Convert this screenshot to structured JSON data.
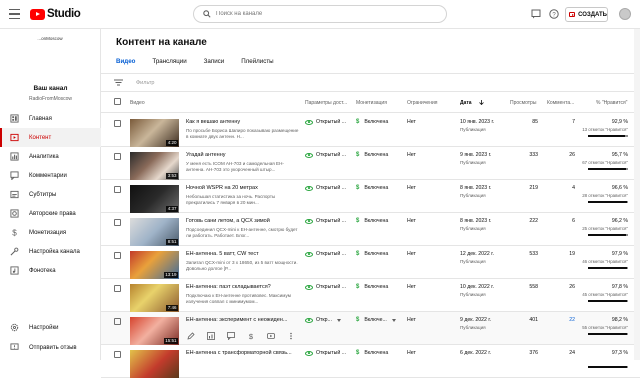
{
  "app": {
    "brand": "Studio",
    "brand_color": "#ff0000",
    "accent": "#065fd4"
  },
  "search": {
    "placeholder": "Поиск на канале"
  },
  "header": {
    "create_label": "СОЗДАТЬ"
  },
  "channel": {
    "logo_text": "...onMoscow",
    "name": "Ваш канал",
    "handle": "RadioFromMoscow"
  },
  "sidebar": {
    "items": [
      {
        "label": "Главная",
        "icon": "dashboard-icon"
      },
      {
        "label": "Контент",
        "icon": "content-icon",
        "active": true
      },
      {
        "label": "Аналитика",
        "icon": "analytics-icon"
      },
      {
        "label": "Комментарии",
        "icon": "comments-icon"
      },
      {
        "label": "Субтитры",
        "icon": "subtitles-icon"
      },
      {
        "label": "Авторские права",
        "icon": "copyright-icon"
      },
      {
        "label": "Монетизация",
        "icon": "monetization-icon"
      },
      {
        "label": "Настройка канала",
        "icon": "customization-icon"
      },
      {
        "label": "Фонотека",
        "icon": "audio-library-icon"
      }
    ],
    "bottom": [
      {
        "label": "Настройки",
        "icon": "settings-icon"
      },
      {
        "label": "Отправить отзыв",
        "icon": "feedback-icon"
      }
    ]
  },
  "main": {
    "title": "Контент на канале",
    "tabs": [
      "Видео",
      "Трансляции",
      "Записи",
      "Плейлисты"
    ],
    "filter_placeholder": "Фильтр",
    "columns": {
      "video": "Видео",
      "visibility": "Параметры дост...",
      "monetization": "Монетизация",
      "restrictions": "Ограничения",
      "date": "Дата",
      "views": "Просмотры",
      "comments": "Коммента...",
      "likes": "% \"Нравится\""
    }
  },
  "videos": [
    {
      "title": "Как я вешаю антенну",
      "desc": "По просьбе Бориса Шапиро показываю размещение в комнате двух антенн. Н...",
      "duration": "4:20",
      "visibility": "Открытый ...",
      "monetization": "Включена",
      "restrictions": "Нет",
      "date": "10 янв. 2023 г.",
      "status": "Публикация",
      "views": "85",
      "comments": "7",
      "likes": "92,9 %",
      "likes_count": "13 отметок \"Нравится\"",
      "ratio": 0.929
    },
    {
      "title": "Угадай антенну",
      "desc": "У меня есть ICOM AH-703 и самодельная EH-антенна. AH-703 это укороченный штыр...",
      "duration": "3:53",
      "visibility": "Открытый ...",
      "monetization": "Включена",
      "restrictions": "Нет",
      "date": "9 янв. 2023 г.",
      "status": "Публикация",
      "views": "333",
      "comments": "26",
      "likes": "95,7 %",
      "likes_count": "67 отметок \"Нравится\"",
      "ratio": 0.957
    },
    {
      "title": "Ночной WSPR на 20 метрах",
      "desc": "Небольшая статистика за ночь. Распорты прекратились 7 января в 20 мин...",
      "duration": "4:37",
      "visibility": "Открытый ...",
      "monetization": "Включена",
      "restrictions": "Нет",
      "date": "8 янв. 2023 г.",
      "status": "Публикация",
      "views": "219",
      "comments": "4",
      "likes": "96,6 %",
      "likes_count": "28 отметок \"Нравится\"",
      "ratio": 0.966
    },
    {
      "title": "Готовь сани летом, а QCX зимой",
      "desc": "Подсоединил QCX-mini к EH-антенне, смотрю будет ли работать. Работает. Блог...",
      "duration": "8:51",
      "visibility": "Открытый ...",
      "monetization": "Включена",
      "restrictions": "Нет",
      "date": "8 янв. 2023 г.",
      "status": "Публикация",
      "views": "222",
      "comments": "6",
      "likes": "96,2 %",
      "likes_count": "25 отметок \"Нравится\"",
      "ratio": 0.962
    },
    {
      "title": "EH-антенна. 5 ватт, CW тест",
      "desc": "Запитал QCX-mini от 3 х 18650, из 5 ватт мощности. Довольно долгое [Р...",
      "duration": "13:19",
      "visibility": "Открытый ...",
      "monetization": "Включена",
      "restrictions": "Нет",
      "date": "12 дек. 2022 г.",
      "status": "Публикация",
      "views": "533",
      "comments": "19",
      "likes": "97,9 %",
      "likes_count": "46 отметок \"Нравится\"",
      "ratio": 0.979
    },
    {
      "title": "EH-антенна: паэт складывается?",
      "desc": "Подключаю к EH-антенне противовес. Максимум излучения совпал с минимумом...",
      "duration": "7:46",
      "visibility": "Открытый ...",
      "monetization": "Включена",
      "restrictions": "Нет",
      "date": "10 дек. 2022 г.",
      "status": "Публикация",
      "views": "558",
      "comments": "26",
      "likes": "97,8 %",
      "likes_count": "45 отметок \"Нравится\"",
      "ratio": 0.978
    },
    {
      "title": "EH-антенна: эксперимент с неожиден...",
      "desc": "",
      "duration": "15:51",
      "visibility": "Откр...",
      "monetization": "Включе...",
      "restrictions": "Нет",
      "date": "9 дек. 2022 г.",
      "status": "Публикация",
      "views": "401",
      "comments": "22",
      "likes": "98,2 %",
      "likes_count": "55 отметок \"Нравится\"",
      "ratio": 0.982,
      "hover": true
    },
    {
      "title": "EH-антенна с трансформаторной связь...",
      "desc": "",
      "duration": "",
      "visibility": "Открытый ...",
      "monetization": "Включена",
      "restrictions": "Нет",
      "date": "6 дек. 2022 г.",
      "status": "",
      "views": "376",
      "comments": "24",
      "likes": "97,3 %",
      "likes_count": "",
      "ratio": 0.973
    }
  ]
}
